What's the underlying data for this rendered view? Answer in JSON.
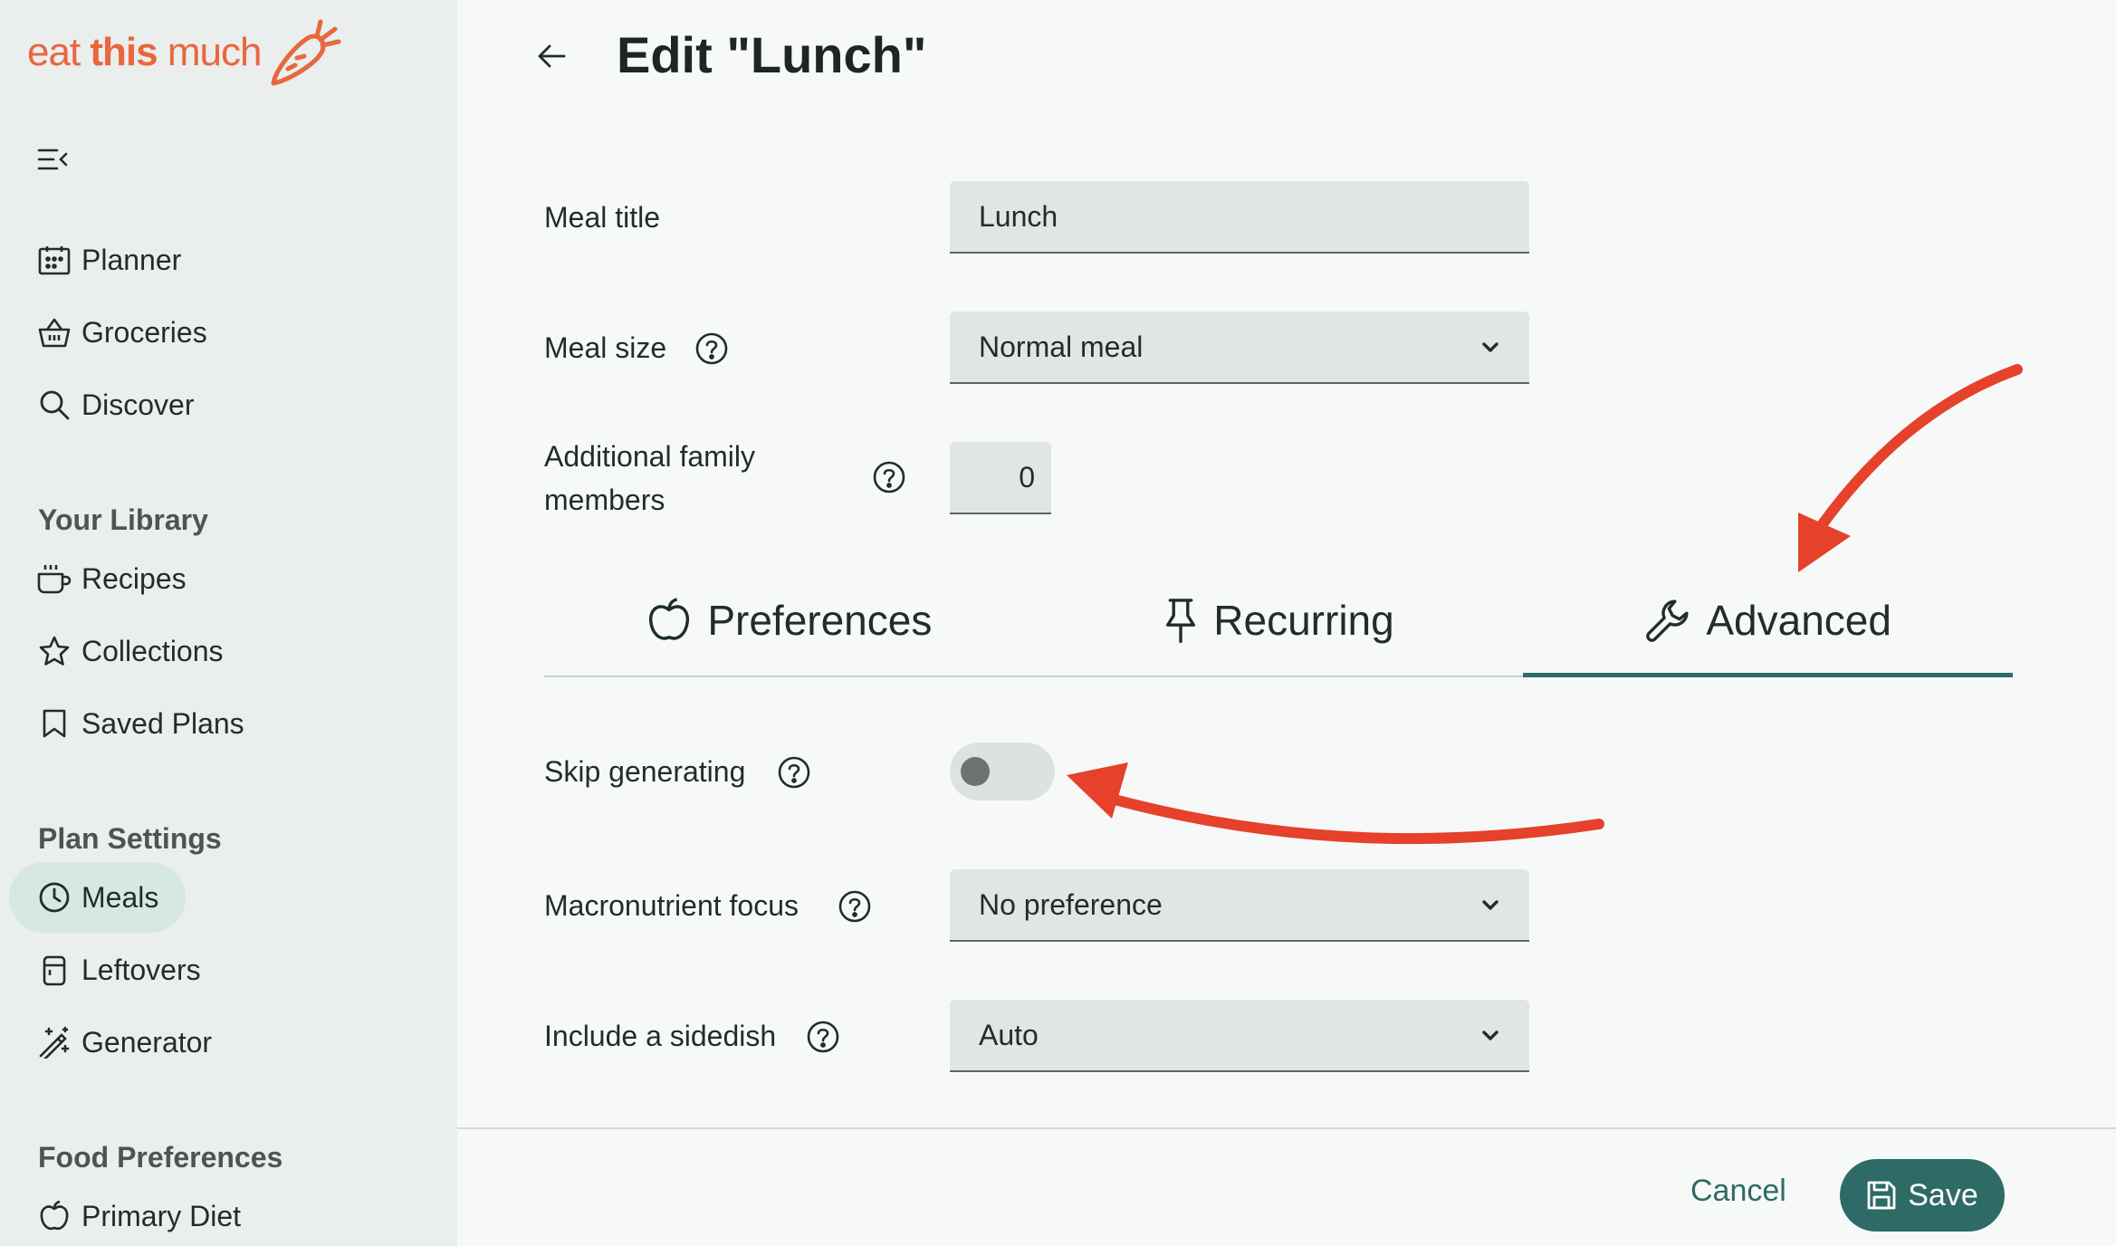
{
  "brand": {
    "logo_eat": "eat ",
    "logo_this": "this",
    "logo_much": " much",
    "color": "#e8673f"
  },
  "sidebar": {
    "nav": [
      {
        "label": "Planner",
        "icon": "calendar-icon"
      },
      {
        "label": "Groceries",
        "icon": "basket-icon"
      },
      {
        "label": "Discover",
        "icon": "search-icon"
      }
    ],
    "library_title": "Your Library",
    "library": [
      {
        "label": "Recipes",
        "icon": "mug-icon"
      },
      {
        "label": "Collections",
        "icon": "star-icon"
      },
      {
        "label": "Saved Plans",
        "icon": "bookmark-icon"
      }
    ],
    "plan_title": "Plan Settings",
    "plan": [
      {
        "label": "Meals",
        "icon": "clock-icon",
        "active": true
      },
      {
        "label": "Leftovers",
        "icon": "container-icon"
      },
      {
        "label": "Generator",
        "icon": "magic-wand-icon"
      }
    ],
    "food_title": "Food Preferences",
    "food": [
      {
        "label": "Primary Diet",
        "icon": "apple-icon"
      }
    ]
  },
  "page": {
    "title": "Edit \"Lunch\""
  },
  "form": {
    "meal_title_label": "Meal title",
    "meal_title_value": "Lunch",
    "meal_size_label": "Meal size",
    "meal_size_value": "Normal meal",
    "family_label_line1": "Additional family",
    "family_label_line2": "members",
    "family_value": "0"
  },
  "tabs": [
    {
      "label": "Preferences",
      "icon": "apple-icon",
      "active": false
    },
    {
      "label": "Recurring",
      "icon": "pin-icon",
      "active": false
    },
    {
      "label": "Advanced",
      "icon": "wrench-icon",
      "active": true
    }
  ],
  "advanced": {
    "skip_label": "Skip generating",
    "skip_on": false,
    "macro_label": "Macronutrient focus",
    "macro_value": "No preference",
    "sidedish_label": "Include a sidedish",
    "sidedish_value": "Auto"
  },
  "footer": {
    "cancel": "Cancel",
    "save": "Save"
  },
  "colors": {
    "accent": "#2e6b66",
    "arrow": "#e5412b"
  }
}
